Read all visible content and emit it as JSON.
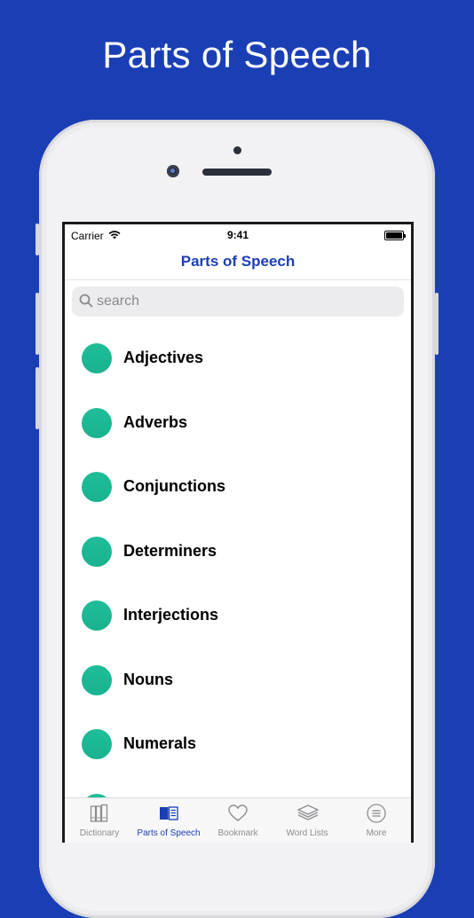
{
  "promo": {
    "headline": "Parts of Speech"
  },
  "status_bar": {
    "carrier": "Carrier",
    "time": "9:41"
  },
  "nav": {
    "title": "Parts of Speech"
  },
  "search": {
    "placeholder": "search",
    "value": ""
  },
  "list": {
    "items": [
      {
        "label": "Adjectives"
      },
      {
        "label": "Adverbs"
      },
      {
        "label": "Conjunctions"
      },
      {
        "label": "Determiners"
      },
      {
        "label": "Interjections"
      },
      {
        "label": "Nouns"
      },
      {
        "label": "Numerals"
      }
    ],
    "dot_color": "#1ebe98"
  },
  "tabs": [
    {
      "label": "Dictionary",
      "icon": "books-icon",
      "active": false
    },
    {
      "label": "Parts of Speech",
      "icon": "open-book-icon",
      "active": true
    },
    {
      "label": "Bookmark",
      "icon": "heart-icon",
      "active": false
    },
    {
      "label": "Word Lists",
      "icon": "stack-icon",
      "active": false
    },
    {
      "label": "More",
      "icon": "menu-circle-icon",
      "active": false
    }
  ],
  "colors": {
    "brand": "#1a3fb5",
    "accent_green": "#1ebe98",
    "inactive_tab": "#8d8d92"
  }
}
